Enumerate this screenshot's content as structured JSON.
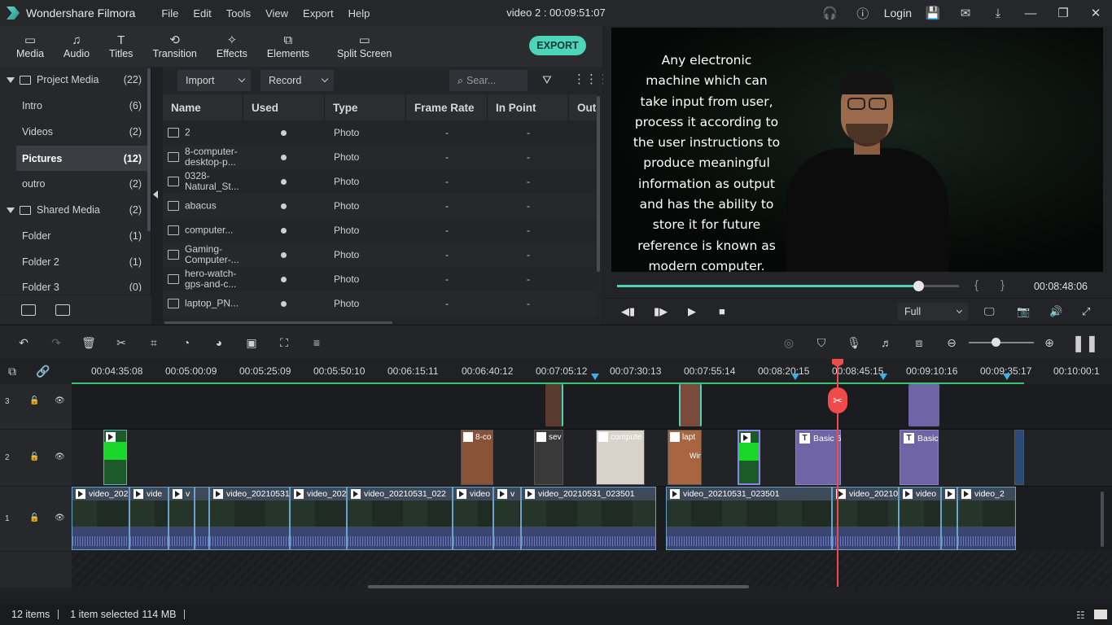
{
  "app": {
    "name": "Wondershare Filmora",
    "window_title": "video 2 : 00:09:51:07",
    "login": "Login"
  },
  "menu": [
    "File",
    "Edit",
    "Tools",
    "View",
    "Export",
    "Help"
  ],
  "tabs": [
    {
      "label": "Media",
      "icon": "folder-icon"
    },
    {
      "label": "Audio",
      "icon": "music-note-icon"
    },
    {
      "label": "Titles",
      "icon": "text-t-icon"
    },
    {
      "label": "Transition",
      "icon": "transition-icon"
    },
    {
      "label": "Effects",
      "icon": "effects-icon"
    },
    {
      "label": "Elements",
      "icon": "elements-icon"
    },
    {
      "label": "Split Screen",
      "icon": "split-screen-icon"
    }
  ],
  "export_label": "EXPORT",
  "sidebar": {
    "project_media": {
      "label": "Project Media",
      "count": "(22)"
    },
    "items": [
      {
        "label": "Intro",
        "count": "(6)"
      },
      {
        "label": "Videos",
        "count": "(2)"
      },
      {
        "label": "Pictures",
        "count": "(12)"
      },
      {
        "label": "outro",
        "count": "(2)"
      }
    ],
    "shared_media": {
      "label": "Shared Media",
      "count": "(2)"
    },
    "shared_items": [
      {
        "label": "Folder",
        "count": "(1)"
      },
      {
        "label": "Folder 2",
        "count": "(1)"
      },
      {
        "label": "Folder 3",
        "count": "(0)"
      }
    ]
  },
  "media": {
    "import_label": "Import",
    "record_label": "Record",
    "search_placeholder": "Sear...",
    "columns": [
      "Name",
      "Used",
      "Type",
      "Frame Rate",
      "In Point",
      "Out"
    ],
    "rows": [
      {
        "name": "2",
        "type": "Photo",
        "frame_rate": "-",
        "in_point": "-"
      },
      {
        "name": "8-computer-desktop-p...",
        "type": "Photo",
        "frame_rate": "-",
        "in_point": "-"
      },
      {
        "name": "0328-Natural_St...",
        "type": "Photo",
        "frame_rate": "-",
        "in_point": "-"
      },
      {
        "name": "abacus",
        "type": "Photo",
        "frame_rate": "-",
        "in_point": "-"
      },
      {
        "name": "computer...",
        "type": "Photo",
        "frame_rate": "-",
        "in_point": "-"
      },
      {
        "name": "Gaming-Computer-...",
        "type": "Photo",
        "frame_rate": "-",
        "in_point": "-"
      },
      {
        "name": "hero-watch-gps-and-c...",
        "type": "Photo",
        "frame_rate": "-",
        "in_point": "-"
      },
      {
        "name": "laptop_PN...",
        "type": "Photo",
        "frame_rate": "-",
        "in_point": "-"
      }
    ]
  },
  "preview": {
    "caption": "Any electronic machine which can take input from user, process it according to the user instructions to produce meaningful information as output and has the ability to store it for future reference is known as modern computer.",
    "timecode": "00:08:48:06",
    "progress": 0.88,
    "quality": "Full"
  },
  "ruler": [
    "00:04:35:08",
    "00:05:00:09",
    "00:05:25:09",
    "00:05:50:10",
    "00:06:15:11",
    "00:06:40:12",
    "00:07:05:12",
    "00:07:30:13",
    "00:07:55:14",
    "00:08:20:15",
    "00:08:45:15",
    "00:09:10:16",
    "00:09:35:17",
    "00:10:00:1"
  ],
  "tracks": {
    "labels": [
      "3",
      "2",
      "1"
    ]
  },
  "clips": {
    "video_track1": [
      "video_202",
      "vide",
      "v",
      "video_20210531_",
      "video_202",
      "video_20210531_022",
      "video",
      "v",
      "video_20210531_023501",
      "video_20210531_023501",
      "video_20210",
      "video",
      "",
      "video_2"
    ],
    "track2_pics": [
      "8-co",
      "sev",
      "compute",
      "lapt",
      "Win"
    ],
    "track2_titles": [
      "Basic 6",
      "Basic"
    ]
  },
  "status": {
    "items": "12 items",
    "selected": "1 item selected",
    "size": "114 MB"
  }
}
